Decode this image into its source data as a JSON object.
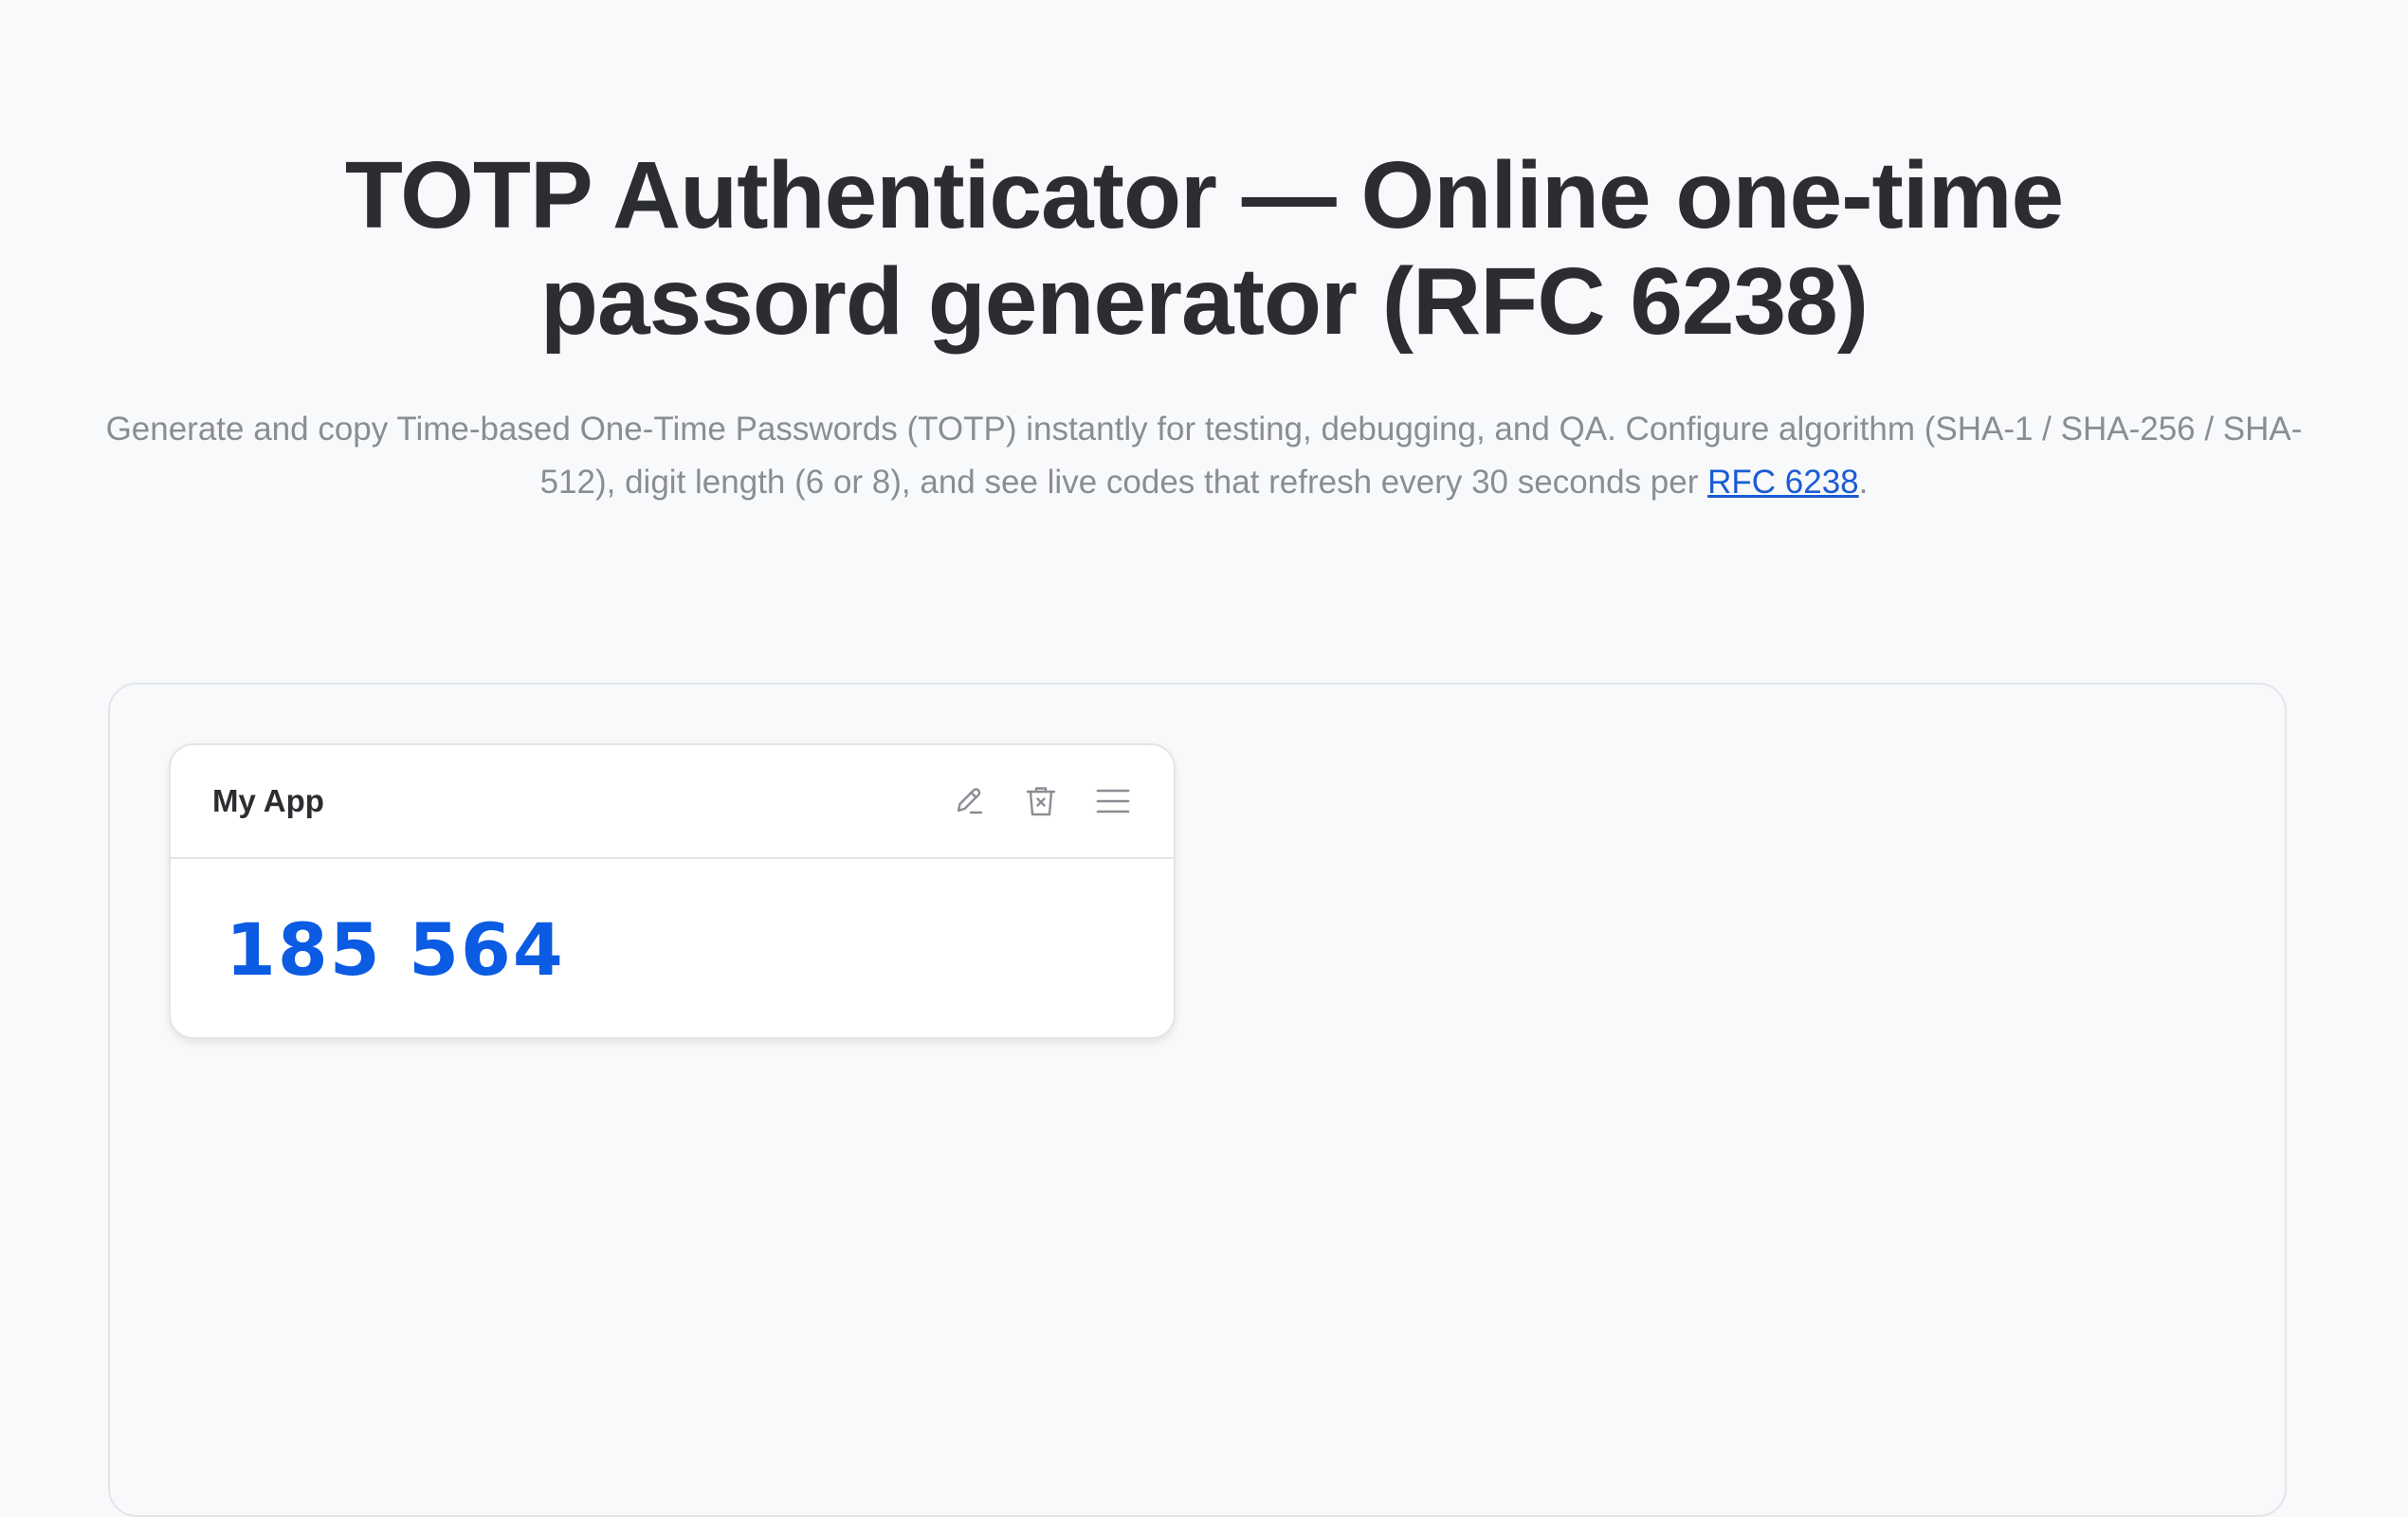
{
  "header": {
    "title": "TOTP Authenticator — Online one-time passord generator (RFC 6238)",
    "subtitle_text": "Generate and copy Time-based One-Time Passwords (TOTP) instantly for testing, debugging, and QA. Configure algorithm (SHA-1 / SHA-256 / SHA-512), digit length (6 or 8), and see live codes that refresh every 30 seconds per ",
    "subtitle_link": "RFC 6238",
    "subtitle_end": "."
  },
  "cards": [
    {
      "name": "My App",
      "code": "185 564",
      "icons": [
        "edit-icon",
        "delete-icon",
        "menu-icon"
      ]
    }
  ],
  "colors": {
    "background": "#f8f9fa",
    "code": "#0b5be3",
    "link": "#1a5bd6",
    "subtitle": "#8a8d93",
    "title": "#2b2d31"
  }
}
